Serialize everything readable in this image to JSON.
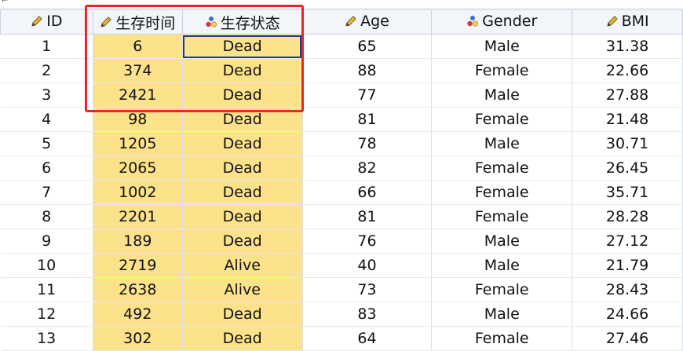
{
  "columns": [
    {
      "key": "id",
      "label": "ID",
      "icon": "pencil-icon"
    },
    {
      "key": "survival_time",
      "label": "生存时间",
      "icon": "pencil-icon"
    },
    {
      "key": "survival_status",
      "label": "生存状态",
      "icon": "nominal-icon"
    },
    {
      "key": "age",
      "label": "Age",
      "icon": "pencil-icon"
    },
    {
      "key": "gender",
      "label": "Gender",
      "icon": "nominal-icon"
    },
    {
      "key": "bmi",
      "label": "BMI",
      "icon": "pencil-icon"
    }
  ],
  "rows": [
    [
      "1",
      "6",
      "Dead",
      "65",
      "Male",
      "31.38"
    ],
    [
      "2",
      "374",
      "Dead",
      "88",
      "Female",
      "22.66"
    ],
    [
      "3",
      "2421",
      "Dead",
      "77",
      "Male",
      "27.88"
    ],
    [
      "4",
      "98",
      "Dead",
      "81",
      "Female",
      "21.48"
    ],
    [
      "5",
      "1205",
      "Dead",
      "78",
      "Male",
      "30.71"
    ],
    [
      "6",
      "2065",
      "Dead",
      "82",
      "Female",
      "26.45"
    ],
    [
      "7",
      "1002",
      "Dead",
      "66",
      "Female",
      "35.71"
    ],
    [
      "8",
      "2201",
      "Dead",
      "81",
      "Female",
      "28.28"
    ],
    [
      "9",
      "189",
      "Dead",
      "76",
      "Male",
      "27.12"
    ],
    [
      "10",
      "2719",
      "Alive",
      "40",
      "Male",
      "21.79"
    ],
    [
      "11",
      "2638",
      "Alive",
      "73",
      "Female",
      "28.43"
    ],
    [
      "12",
      "492",
      "Dead",
      "83",
      "Male",
      "24.66"
    ],
    [
      "13",
      "302",
      "Dead",
      "64",
      "Female",
      "27.46"
    ]
  ],
  "selection": {
    "row": 1,
    "column": "survival_status"
  },
  "colors": {
    "highlight": "#fde28c",
    "annotation_box": "#e8262c",
    "selected_border": "#1f3a8a"
  }
}
